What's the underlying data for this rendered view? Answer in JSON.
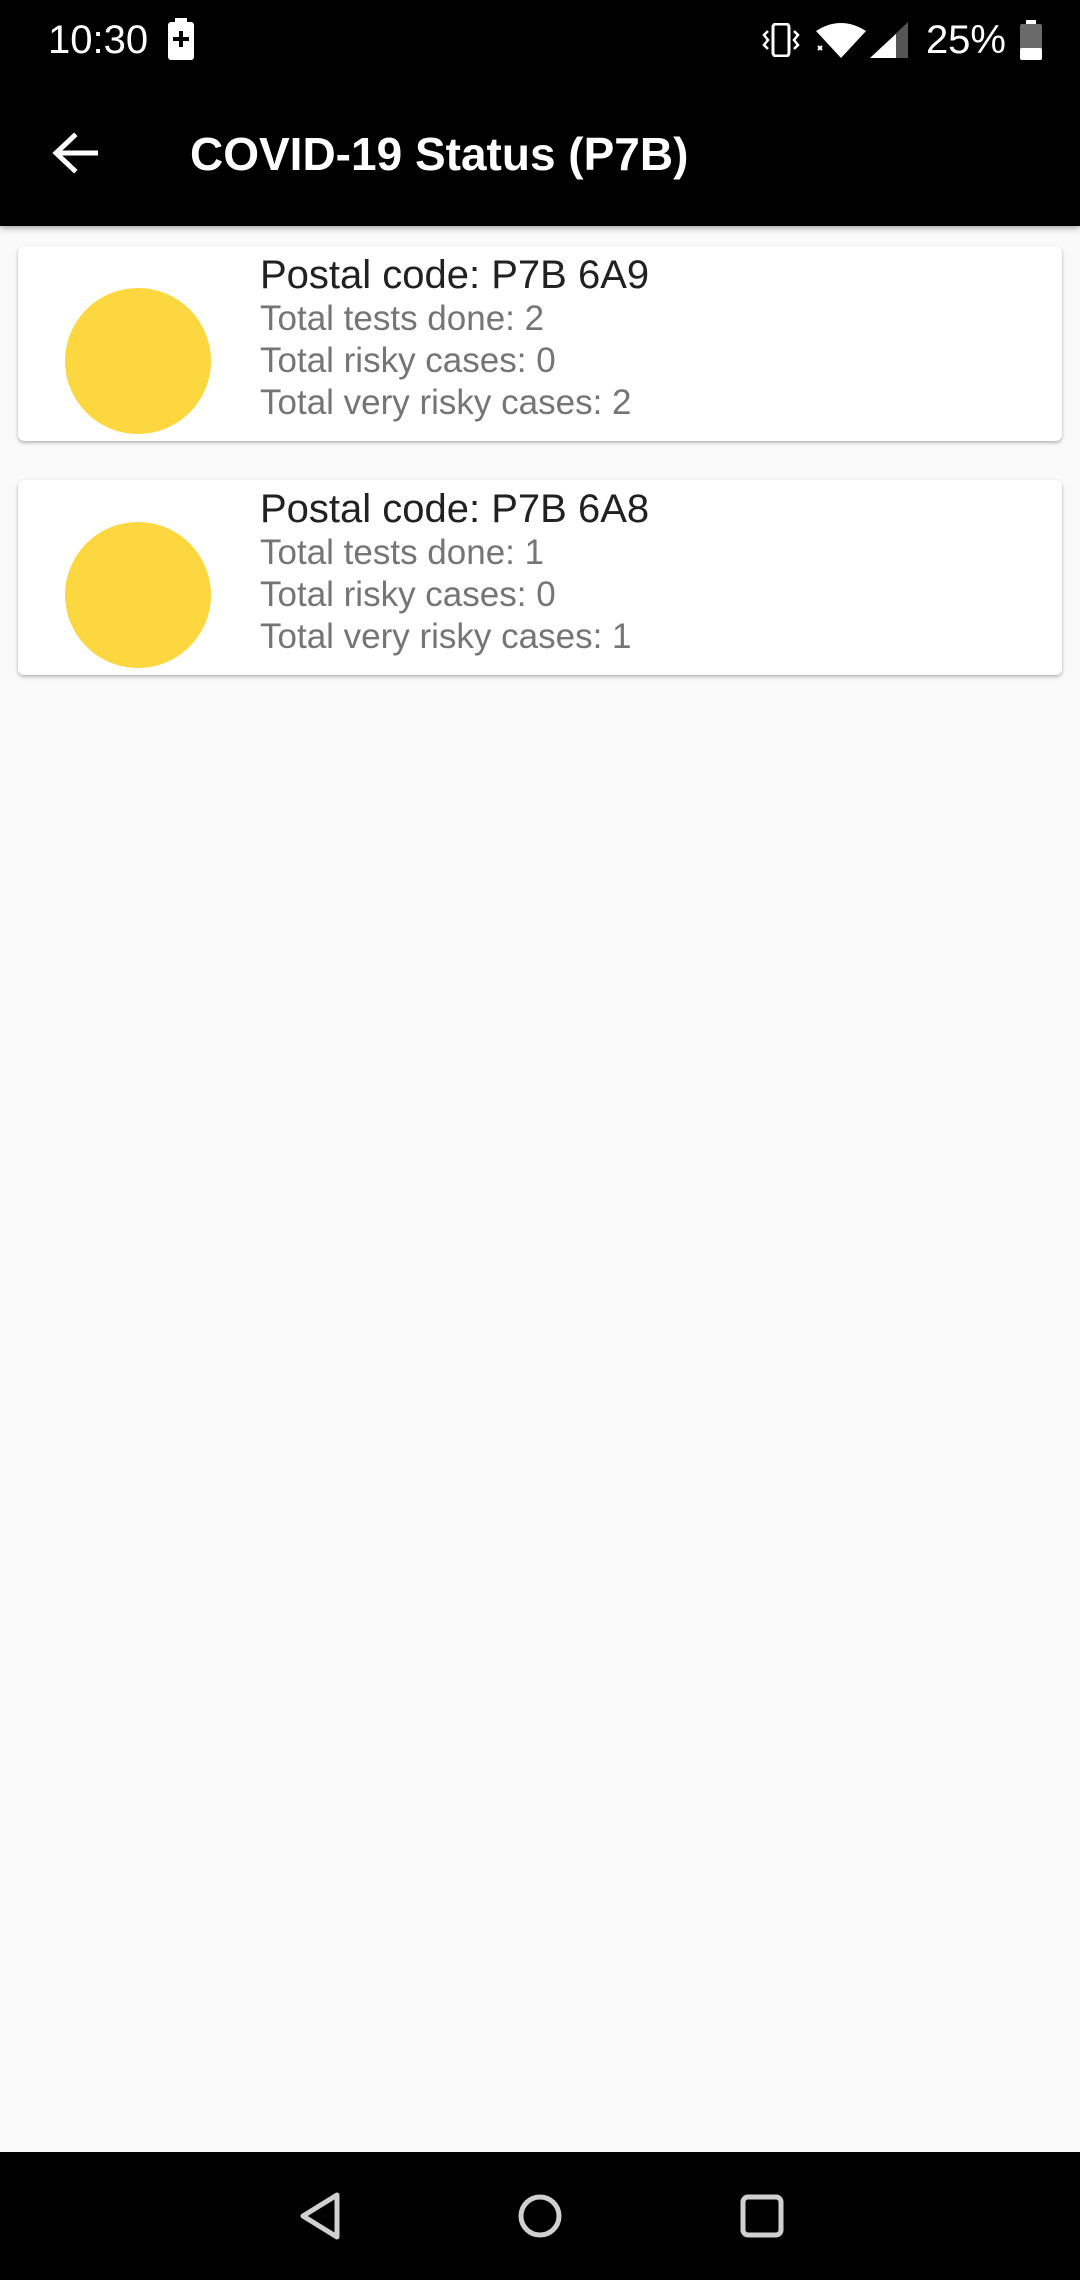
{
  "status_bar": {
    "time": "10:30",
    "battery_percent": "25%",
    "icons": [
      "battery-charging-icon",
      "vibrate-icon",
      "wifi-icon",
      "signal-icon",
      "battery-icon"
    ]
  },
  "app_bar": {
    "title": "COVID-19 Status (P7B)",
    "back_icon": "arrow-back-icon"
  },
  "cards": [
    {
      "postal": "Postal code: P7B 6A9",
      "tests": "Total tests done: 2",
      "risky": "Total risky cases: 0",
      "very_risky": "Total very risky cases: 2",
      "status_color": "#FDD73F"
    },
    {
      "postal": "Postal code: P7B 6A8",
      "tests": "Total tests done: 1",
      "risky": "Total risky cases: 0",
      "very_risky": "Total very risky cases: 1",
      "status_color": "#FDD73F"
    }
  ],
  "nav_bar": {
    "icons": [
      "nav-back-icon",
      "nav-home-icon",
      "nav-recents-icon"
    ]
  },
  "colors": {
    "bar_background": "#000000",
    "page_background": "#FAFAFA",
    "status_yellow": "#FDD73F"
  }
}
